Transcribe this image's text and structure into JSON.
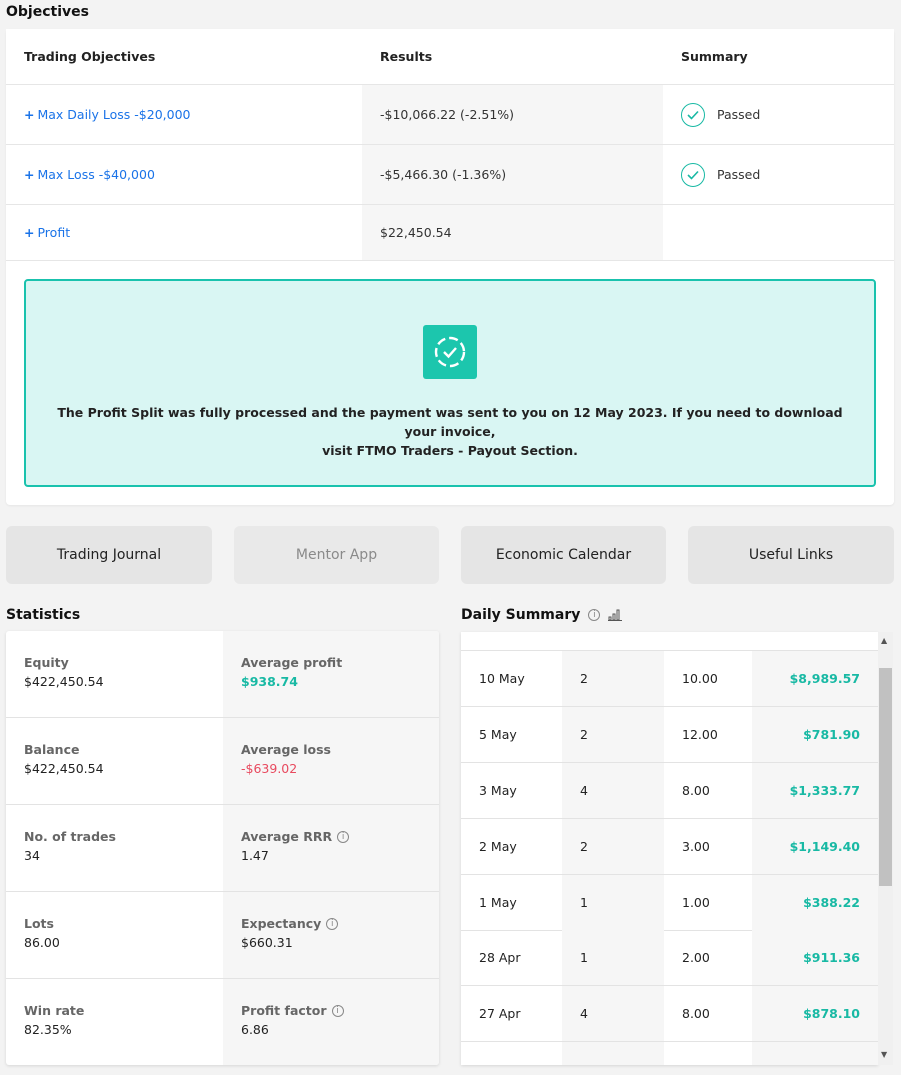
{
  "objectives": {
    "title": "Objectives",
    "headers": [
      "Trading Objectives",
      "Results",
      "Summary"
    ],
    "rows": [
      {
        "objective": "Max Daily Loss -$20,000",
        "result": "-$10,066.22 (-2.51%)",
        "summary": "Passed"
      },
      {
        "objective": "Max Loss -$40,000",
        "result": "-$5,466.30 (-1.36%)",
        "summary": "Passed"
      },
      {
        "objective": "Profit",
        "result": "$22,450.54",
        "summary": ""
      }
    ],
    "plus": "+",
    "banner_line1": "The Profit Split was fully processed and the payment was sent to you on 12 May 2023. If you need to download your invoice,",
    "banner_line2": "visit FTMO Traders - Payout Section."
  },
  "nav_buttons": [
    "Trading Journal",
    "Mentor App",
    "Economic Calendar",
    "Useful Links"
  ],
  "statistics": {
    "title": "Statistics",
    "rows": [
      {
        "left_label": "Equity",
        "left_value": "$422,450.54",
        "right_label": "Average profit",
        "right_value": "$938.74"
      },
      {
        "left_label": "Balance",
        "left_value": "$422,450.54",
        "right_label": "Average loss",
        "right_value": "-$639.02"
      },
      {
        "left_label": "No. of trades",
        "left_value": "34",
        "right_label": "Average RRR",
        "right_value": "1.47"
      },
      {
        "left_label": "Lots",
        "left_value": "86.00",
        "right_label": "Expectancy",
        "right_value": "$660.31"
      },
      {
        "left_label": "Win rate",
        "left_value": "82.35%",
        "right_label": "Profit factor",
        "right_value": "6.86"
      }
    ]
  },
  "daily_summary": {
    "title": "Daily Summary",
    "rows": [
      {
        "date": "10 May",
        "trades": "2",
        "lots": "10.00",
        "result": "$8,989.57"
      },
      {
        "date": "5 May",
        "trades": "2",
        "lots": "12.00",
        "result": "$781.90"
      },
      {
        "date": "3 May",
        "trades": "4",
        "lots": "8.00",
        "result": "$1,333.77"
      },
      {
        "date": "2 May",
        "trades": "2",
        "lots": "3.00",
        "result": "$1,149.40"
      },
      {
        "date": "1 May",
        "trades": "1",
        "lots": "1.00",
        "result": "$388.22"
      },
      {
        "date": "28 Apr",
        "trades": "1",
        "lots": "2.00",
        "result": "$911.36"
      },
      {
        "date": "27 Apr",
        "trades": "4",
        "lots": "8.00",
        "result": "$878.10"
      }
    ]
  },
  "colors": {
    "accent": "#18b9a4",
    "link": "#1a73e8",
    "negative": "#e84a5f"
  },
  "icons": [
    "check-circle-icon",
    "payout-check-icon",
    "info-icon",
    "bar-chart-icon"
  ]
}
